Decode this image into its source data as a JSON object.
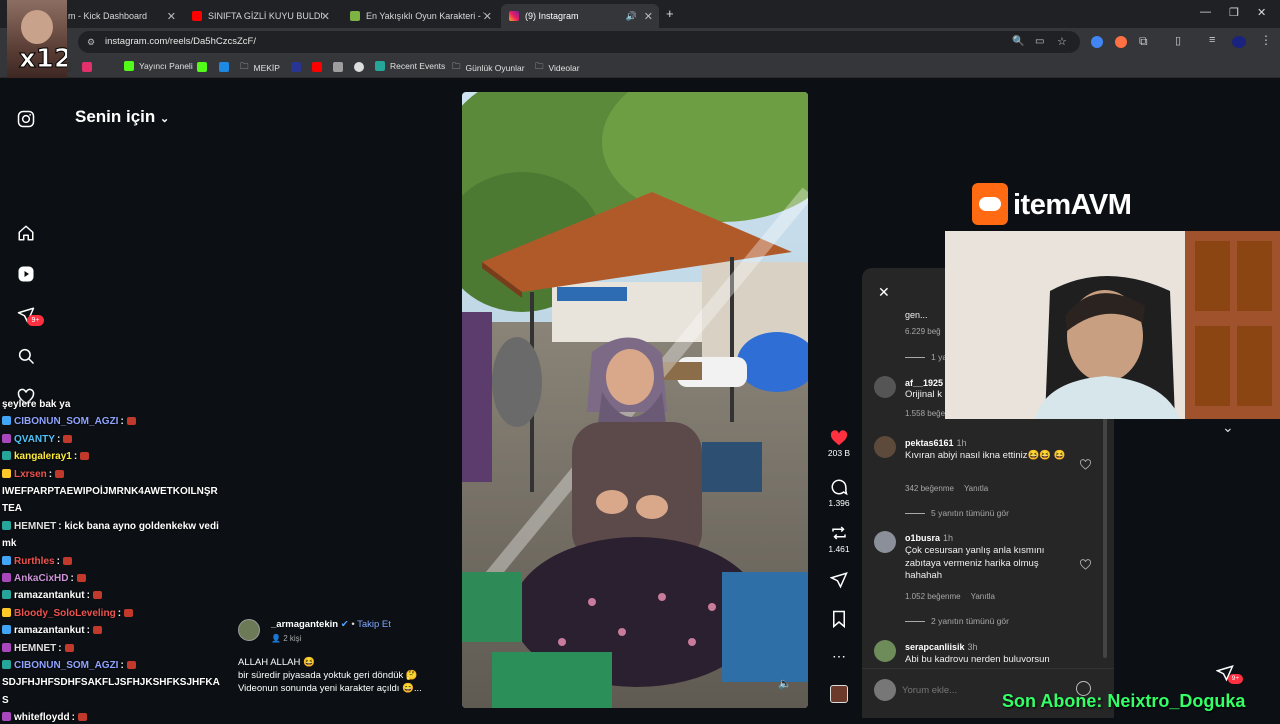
{
  "browser": {
    "tabs": [
      {
        "label": "m - Kick Dashboard",
        "active": false
      },
      {
        "label": "SINIFTA GİZLİ KUYU BULDUK!",
        "active": false
      },
      {
        "label": "En Yakışıklı Oyun Karakteri - Ti",
        "active": false
      },
      {
        "label": "(9) Instagram",
        "active": true
      }
    ],
    "url": "instagram.com/reels/Da5hCzcsZcF/",
    "bookmarks": [
      "Yayıncı Paneli",
      "MEKİP",
      "Recent Events",
      "Günlük Oyunlar",
      "Videolar"
    ]
  },
  "overlay": {
    "multiplier": "x12",
    "brand_logo": "itemAVM",
    "ticker": "Son Abone: Neixtro_Doguka"
  },
  "instagram": {
    "feed_title": "Senin için",
    "notif_badge": "9+",
    "reel": {
      "username": "_armagantekin",
      "follow_label": "Takip Et",
      "audience": "2 kişi",
      "caption_line1": "ALLAH ALLAH 😆",
      "caption_line2": "bir süredir piyasada yoktuk geri döndük 🤔",
      "caption_line3": "Videonun sonunda yeni karakter açıldı 😄..."
    },
    "actions": {
      "likes": "203 B",
      "comments": "1.396",
      "shares": "1.461"
    },
    "comments": {
      "partial_top": {
        "text": "gen...",
        "likes": "6.229 beğ",
        "replies": "1 ya"
      },
      "af": {
        "user": "af__1925",
        "text": "Orijinal k",
        "likes": "1.558 beğe"
      },
      "items": [
        {
          "user": "pektas6161",
          "age": "1h",
          "text": "Kıvıran abiyi nasıl ikna ettiniz😆😆 😆",
          "likes": "342 beğenme",
          "reply": "Yanıtla",
          "more": "5 yanıtın tümünü gör"
        },
        {
          "user": "o1busra",
          "age": "1h",
          "text": "Çok cesursan yanlış anla kısmını zabıtaya vermeniz harika olmuş hahahah",
          "likes": "1.052 beğenme",
          "reply": "Yanıtla",
          "more": "2 yanıtın tümünü gör"
        },
        {
          "user": "serapcanliisik",
          "age": "3h",
          "text": "Abi bu kadrovu nerden buluvorsun"
        }
      ],
      "input_placeholder": "Yorum ekle..."
    }
  },
  "chat": [
    {
      "user": "",
      "text": "şeylere bak ya",
      "color": "#ffffff"
    },
    {
      "user": "CIBONUN_SOM_AGZI",
      "text": ":",
      "color": "#8fa3ff"
    },
    {
      "user": "QVANTY",
      "text": ":",
      "color": "#4fc3f7"
    },
    {
      "user": "kangaleray1",
      "text": ":",
      "color": "#ffeb3b"
    },
    {
      "user": "Lxrsen",
      "text": ":",
      "color": "#ef5350"
    },
    {
      "user": "",
      "text": "IWEFPARPTAEWIPOİJMRNK4AWETKOILNŞR",
      "color": "#ffffff"
    },
    {
      "user": "",
      "text": "TEA",
      "color": "#ffffff"
    },
    {
      "user": "HEMNET",
      "text": ": kick bana ayno goldenkekw vedi",
      "color": "#e0e0e0"
    },
    {
      "user": "",
      "text": "mk",
      "color": "#ffffff"
    },
    {
      "user": "Rurthles",
      "text": ":",
      "color": "#ef5350"
    },
    {
      "user": "AnkaCixHD",
      "text": ":",
      "color": "#ce93d8"
    },
    {
      "user": "ramazantankut",
      "text": ":",
      "color": "#ffffff"
    },
    {
      "user": "Bloody_SoloLeveling",
      "text": ":",
      "color": "#ef5350"
    },
    {
      "user": "ramazantankut",
      "text": ":",
      "color": "#ffffff"
    },
    {
      "user": "HEMNET",
      "text": ":",
      "color": "#e0e0e0"
    },
    {
      "user": "CIBONUN_SOM_AGZI",
      "text": ":",
      "color": "#8fa3ff"
    },
    {
      "user": "",
      "text": "SDJFHJHFSDHFSAKFLJSFHJKSHFKSJHFKA",
      "color": "#ffffff"
    },
    {
      "user": "",
      "text": "S",
      "color": "#ffffff"
    },
    {
      "user": "whitefloydd",
      "text": ":",
      "color": "#ffffff"
    }
  ]
}
